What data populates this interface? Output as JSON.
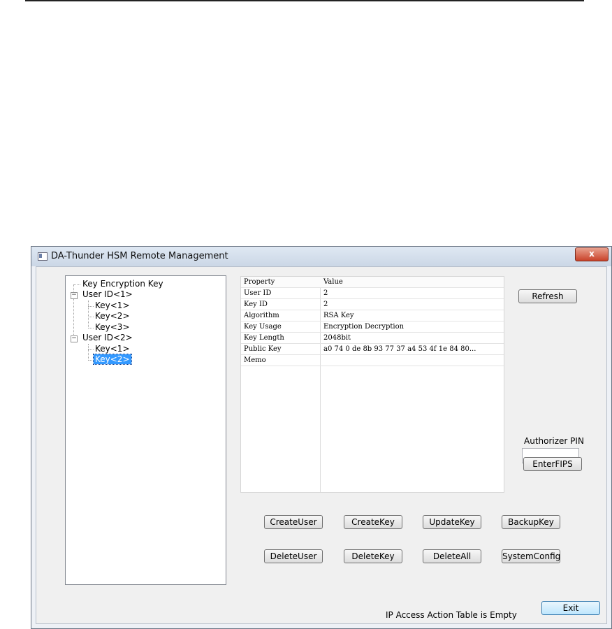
{
  "window": {
    "title": "DA-Thunder HSM Remote Management",
    "close_glyph": "x"
  },
  "tree": {
    "items": [
      {
        "label": "Key Encryption Key",
        "level": 0
      },
      {
        "label": "User ID<1>",
        "level": 0,
        "expanded": true
      },
      {
        "label": "Key<1>",
        "level": 1
      },
      {
        "label": "Key<2>",
        "level": 1
      },
      {
        "label": "Key<3>",
        "level": 1
      },
      {
        "label": "User ID<2>",
        "level": 0,
        "expanded": true
      },
      {
        "label": "Key<1>",
        "level": 1
      },
      {
        "label": "Key<2>",
        "level": 1,
        "selected": true
      }
    ],
    "expanded_glyph": "−"
  },
  "grid": {
    "header": {
      "property": "Property",
      "value": "Value"
    },
    "rows": [
      {
        "property": "User ID",
        "value": "2"
      },
      {
        "property": "Key ID",
        "value": "2"
      },
      {
        "property": "Algorithm",
        "value": "RSA Key"
      },
      {
        "property": "Key Usage",
        "value": "Encryption Decryption"
      },
      {
        "property": "Key Length",
        "value": "2048bit"
      },
      {
        "property": "Public Key",
        "value": "a0 74 0 de 8b 93 77 37 a4 53 4f 1e 84 80..."
      },
      {
        "property": "Memo",
        "value": ""
      }
    ]
  },
  "side": {
    "refresh": "Refresh",
    "pin_label": "Authorizer PIN",
    "pin_value": "",
    "enter_fips": "EnterFIPS"
  },
  "actions": {
    "create_user": "CreateUser",
    "create_key": "CreateKey",
    "update_key": "UpdateKey",
    "backup_key": "BackupKey",
    "delete_user": "DeleteUser",
    "delete_key": "DeleteKey",
    "delete_all": "DeleteAll",
    "system_config": "SystemConfig"
  },
  "status": "IP Access Action Table is Empty",
  "exit": "Exit"
}
